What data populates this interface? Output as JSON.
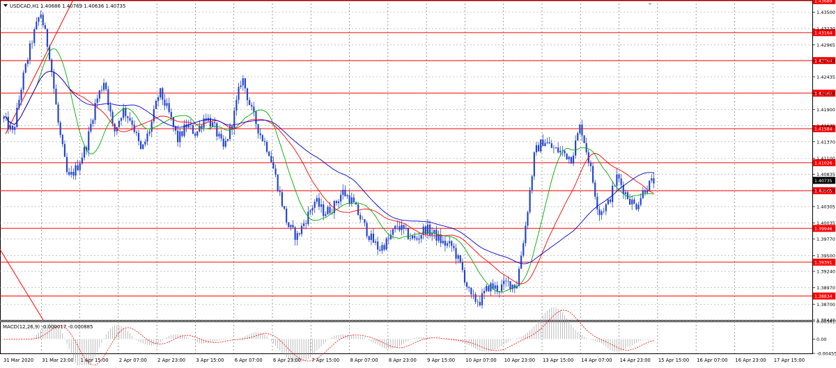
{
  "header": {
    "symbol": "USDCAD,H1",
    "ohlc": "1.40686 1.40769 1.40636 1.40735"
  },
  "macd_panel": {
    "label": "MACD(12,26,9) -0.000017 -0.000885"
  },
  "chart_data": [
    {
      "type": "candlestick",
      "title": "USDCAD,H1",
      "ylim": [
        1.3844,
        1.437
      ],
      "y_ticks": [
        "1.43500",
        "1.43230",
        "1.42965",
        "1.42700",
        "1.42435",
        "1.42165",
        "1.41900",
        "1.41635",
        "1.41370",
        "1.41100",
        "1.40835",
        "1.40570",
        "1.40305",
        "1.40035",
        "1.39770",
        "1.39500",
        "1.39240",
        "1.38970",
        "1.38700",
        "1.38440"
      ],
      "x_ticks": [
        "31 Mar 2020",
        "31 Mar 23:00",
        "1 Apr 15:00",
        "2 Apr 07:00",
        "2 Apr 23:00",
        "3 Apr 15:00",
        "6 Apr 07:00",
        "6 Apr 23:00",
        "7 Apr 15:00",
        "8 Apr 07:00",
        "8 Apr 23:00",
        "9 Apr 15:00",
        "10 Apr 07:00",
        "10 Apr 23:00",
        "13 Apr 15:00",
        "14 Apr 07:00",
        "14 Apr 23:00",
        "15 Apr 15:00",
        "16 Apr 07:00",
        "16 Apr 23:00",
        "17 Apr 15:00"
      ],
      "current_price": "1.40735",
      "horizontal_levels": [
        {
          "label": "1.43689",
          "value": 1.43689,
          "color": "#ff0000"
        },
        {
          "label": "1.43164",
          "value": 1.43164,
          "color": "#ff0000"
        },
        {
          "label": "1.42704",
          "value": 1.42704,
          "color": "#ff0000"
        },
        {
          "label": "1.42169",
          "value": 1.42169,
          "color": "#ff0000"
        },
        {
          "label": "1.41584",
          "value": 1.41584,
          "color": "#ff0000"
        },
        {
          "label": "1.41026",
          "value": 1.41026,
          "color": "#ff0000"
        },
        {
          "label": "1.40565",
          "value": 1.40565,
          "color": "#ff0000"
        },
        {
          "label": "1.39946",
          "value": 1.39946,
          "color": "#ff0000"
        },
        {
          "label": "1.39391",
          "value": 1.39391,
          "color": "#ff0000"
        },
        {
          "label": "1.38834",
          "value": 1.38834,
          "color": "#ff0000"
        }
      ],
      "price_path": [
        1.4175,
        1.415,
        1.4235,
        1.43,
        1.435,
        1.428,
        1.416,
        1.4075,
        1.4095,
        1.413,
        1.42,
        1.424,
        1.415,
        1.419,
        1.417,
        1.412,
        1.416,
        1.422,
        1.4185,
        1.414,
        1.4165,
        1.415,
        1.418,
        1.416,
        1.4125,
        1.417,
        1.4245,
        1.419,
        1.415,
        1.412,
        1.406,
        1.4,
        1.398,
        1.401,
        1.404,
        1.402,
        1.403,
        1.4055,
        1.404,
        1.401,
        1.398,
        1.396,
        1.3975,
        1.4,
        1.3985,
        1.3975,
        1.3995,
        1.3985,
        1.397,
        1.3965,
        1.393,
        1.388,
        1.3875,
        1.39,
        1.3895,
        1.3905,
        1.39,
        1.4,
        1.412,
        1.414,
        1.4125,
        1.412,
        1.411,
        1.4165,
        1.41,
        1.402,
        1.4035,
        1.408,
        1.405,
        1.403,
        1.406,
        1.4073
      ],
      "moving_averages": [
        {
          "color": "#00aa00",
          "period_shift": 5
        },
        {
          "color": "#ff0000",
          "period_shift": 10
        },
        {
          "color": "#0000cc",
          "period_shift": 18
        }
      ],
      "colors": {
        "candles": "#2244cc",
        "grid": "#808080",
        "levels": "#ff0000"
      }
    },
    {
      "type": "bar",
      "title": "MACD(12,26,9) -0.000017 -0.000885",
      "ylim": [
        -0.004556,
        0.005619
      ],
      "y_ticks": [
        "0.005619",
        "0.00",
        "-0.004556"
      ],
      "values_main": -1.7e-05,
      "values_signal": -0.000885
    }
  ]
}
